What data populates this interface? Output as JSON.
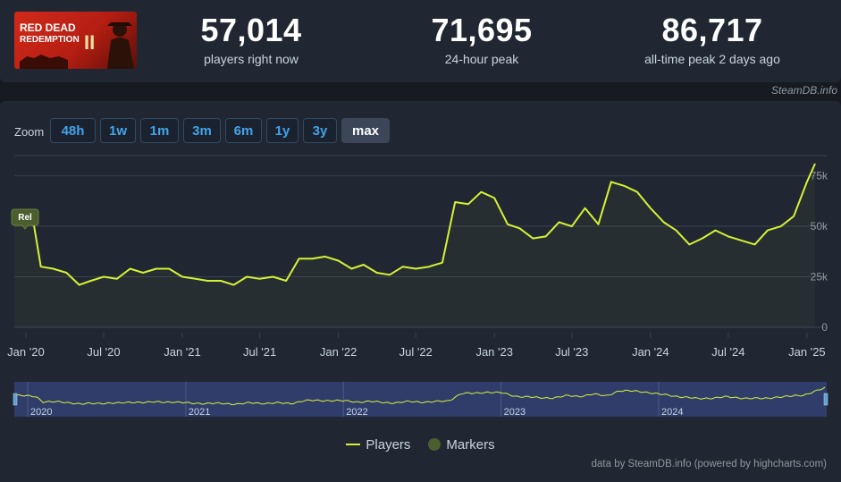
{
  "game": {
    "title": "Red Dead Redemption 2",
    "logo_text_line1": "RED DEAD",
    "logo_text_line2": "REDEMPTION",
    "logo_numeral": "II"
  },
  "stats": [
    {
      "value": "57,014",
      "label": "players right now"
    },
    {
      "value": "71,695",
      "label": "24-hour peak"
    },
    {
      "value": "86,717",
      "label": "all-time peak 2 days ago"
    }
  ],
  "brand": "SteamDB.info",
  "zoom": {
    "label": "Zoom",
    "options": [
      "48h",
      "1w",
      "1m",
      "3m",
      "6m",
      "1y",
      "3y",
      "max"
    ],
    "active": "max"
  },
  "legend": {
    "players": "Players",
    "markers": "Markers"
  },
  "credits": "data by SteamDB.info (powered by highcharts.com)",
  "colors": {
    "line": "#d6f236",
    "marker": "#4a5e2e",
    "navigator_bg": "#303d6b",
    "background": "#212732"
  },
  "chart_data": {
    "type": "line",
    "x_tick_labels": [
      "Jan '20",
      "Jul '20",
      "Jan '21",
      "Jul '21",
      "Jan '22",
      "Jul '22",
      "Jan '23",
      "Jul '23",
      "Jan '24",
      "Jul '24",
      "Jan '25"
    ],
    "y_tick_labels": [
      "0",
      "25k",
      "50k",
      "75k"
    ],
    "ylim": [
      0,
      85000
    ],
    "grid": true,
    "legend_position": "bottom-center",
    "marker_label": "Rel",
    "series": [
      {
        "name": "Players",
        "x": [
          "2019-12-05",
          "2019-12-20",
          "2020-01-05",
          "2020-01-20",
          "2020-02-05",
          "2020-03-05",
          "2020-04-05",
          "2020-05-05",
          "2020-06-01",
          "2020-07-01",
          "2020-08-01",
          "2020-09-01",
          "2020-10-01",
          "2020-11-01",
          "2020-12-01",
          "2021-01-01",
          "2021-02-01",
          "2021-03-01",
          "2021-04-01",
          "2021-05-01",
          "2021-06-01",
          "2021-07-01",
          "2021-08-01",
          "2021-09-01",
          "2021-10-01",
          "2021-11-01",
          "2021-12-01",
          "2022-01-01",
          "2022-02-01",
          "2022-03-01",
          "2022-04-01",
          "2022-05-01",
          "2022-06-01",
          "2022-07-01",
          "2022-08-01",
          "2022-09-01",
          "2022-10-01",
          "2022-11-01",
          "2022-12-01",
          "2023-01-01",
          "2023-02-01",
          "2023-03-01",
          "2023-04-01",
          "2023-05-01",
          "2023-06-01",
          "2023-07-01",
          "2023-08-01",
          "2023-09-01",
          "2023-10-01",
          "2023-11-01",
          "2023-12-01",
          "2024-01-01",
          "2024-02-01",
          "2024-03-01",
          "2024-04-01",
          "2024-05-01",
          "2024-06-01",
          "2024-07-01",
          "2024-08-01",
          "2024-09-01",
          "2024-10-01",
          "2024-11-01",
          "2024-12-01",
          "2025-01-01",
          "2025-01-20"
        ],
        "values": [
          54000,
          52000,
          51000,
          50500,
          30000,
          29000,
          27000,
          21000,
          23000,
          25000,
          24000,
          29000,
          27000,
          29000,
          29000,
          25000,
          24000,
          23000,
          23000,
          21000,
          25000,
          24000,
          25000,
          23000,
          34000,
          34000,
          35000,
          33000,
          29000,
          31000,
          27000,
          26000,
          30000,
          29000,
          30000,
          32000,
          62000,
          61000,
          67000,
          64000,
          51000,
          49000,
          44000,
          45000,
          52000,
          50000,
          59000,
          51000,
          72000,
          70000,
          67000,
          59000,
          52000,
          48000,
          41000,
          44000,
          48000,
          45000,
          43000,
          41000,
          48000,
          50000,
          55000,
          72000,
          81000
        ]
      }
    ],
    "navigator_labels": [
      "2020",
      "2021",
      "2022",
      "2023",
      "2024"
    ]
  }
}
